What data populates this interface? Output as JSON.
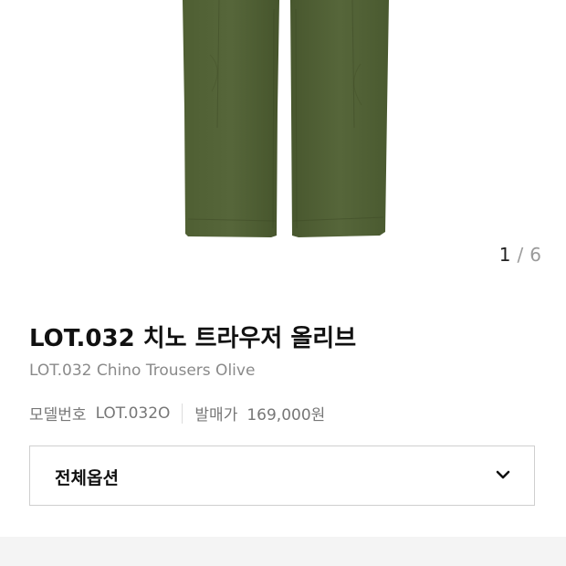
{
  "gallery": {
    "current_index": "1",
    "separator": "/",
    "total": "6"
  },
  "product": {
    "name": "LOT.032 치노 트라우저 올리브",
    "english_name": "LOT.032 Chino Trousers Olive",
    "model_label": "모델번호",
    "model_number": "LOT.032O",
    "release_price_label": "발매가",
    "release_price": "169,000원"
  },
  "options": {
    "selected": "전체옵션"
  },
  "colors": {
    "product_olive": "#4b5b30",
    "text_primary": "#111111",
    "text_secondary": "#8a8a8a",
    "border": "#cfcfcf",
    "strip": "#f4f4f4"
  },
  "icons": {
    "select_toggle": "chevron-down-icon"
  }
}
